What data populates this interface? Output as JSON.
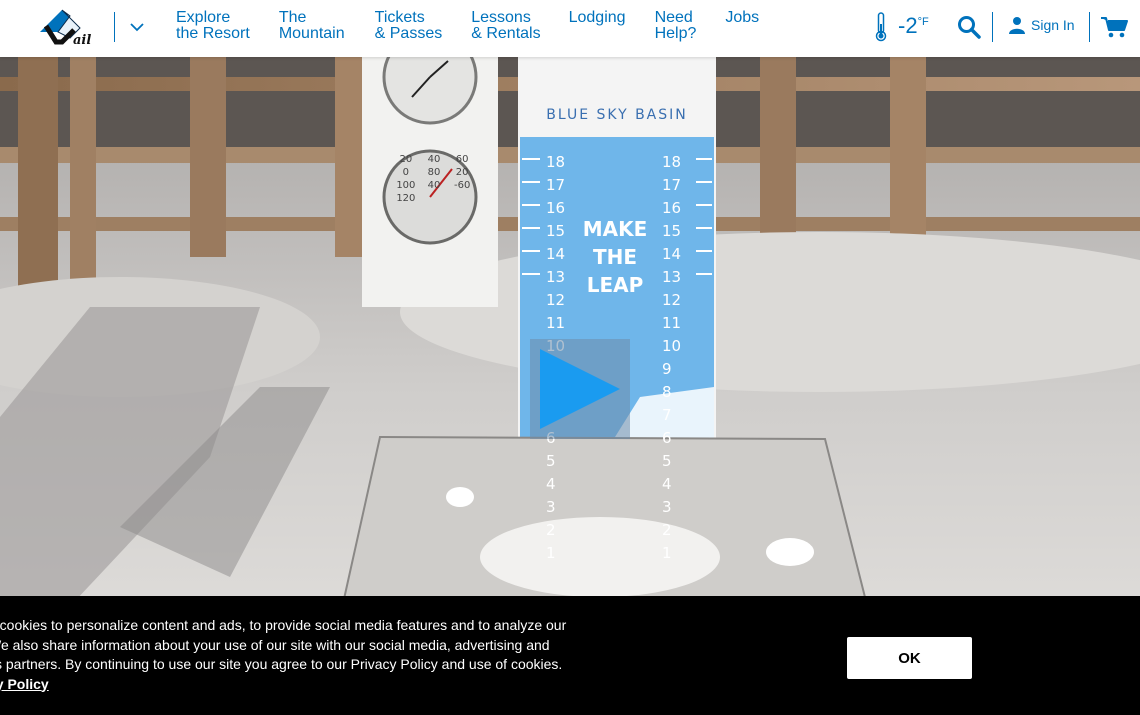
{
  "header": {
    "logo_alt": "Vail",
    "nav": [
      {
        "line1": "Explore",
        "line2": "the Resort"
      },
      {
        "line1": "The",
        "line2": "Mountain"
      },
      {
        "line1": "Tickets",
        "line2": "& Passes"
      },
      {
        "line1": "Lessons",
        "line2": "& Rentals"
      },
      {
        "line1": "Lodging",
        "line2": ""
      },
      {
        "line1": "Need",
        "line2": "Help?"
      },
      {
        "line1": "Jobs",
        "line2": ""
      }
    ],
    "temperature": "-2",
    "temperature_unit": "°F",
    "sign_in_label": "Sign In"
  },
  "webcam": {
    "board_title": "BLUE SKY BASIN",
    "board_slogan": [
      "MAKE",
      "THE",
      "LEAP"
    ],
    "left_numbers": [
      "18",
      "17",
      "16",
      "15",
      "14",
      "13",
      "12",
      "11",
      "10",
      "9",
      "8",
      "7",
      "6",
      "5",
      "4",
      "3",
      "2",
      "1"
    ],
    "right_numbers": [
      "18",
      "17",
      "16",
      "15",
      "14",
      "13",
      "12",
      "11",
      "10",
      "9",
      "8",
      "7",
      "6",
      "5",
      "4",
      "3",
      "2",
      "1"
    ],
    "thermo_numbers": [
      "20",
      "40",
      "60",
      "0",
      "80",
      "20",
      "100",
      "40",
      "-60",
      "120"
    ]
  },
  "cookie_banner": {
    "line1": "e cookies to personalize content and ads, to provide social media features and to analyze our",
    "line2": " We also share information about your use of our site with our social media, advertising and",
    "line3": "cs partners. By continuing to use our site you agree to our Privacy Policy and use of cookies.",
    "link": "cy Policy",
    "ok_label": "OK"
  },
  "colors": {
    "brand_blue": "#0072bc",
    "banner_bg": "#000000",
    "board_blue": "#6fb6ea"
  }
}
